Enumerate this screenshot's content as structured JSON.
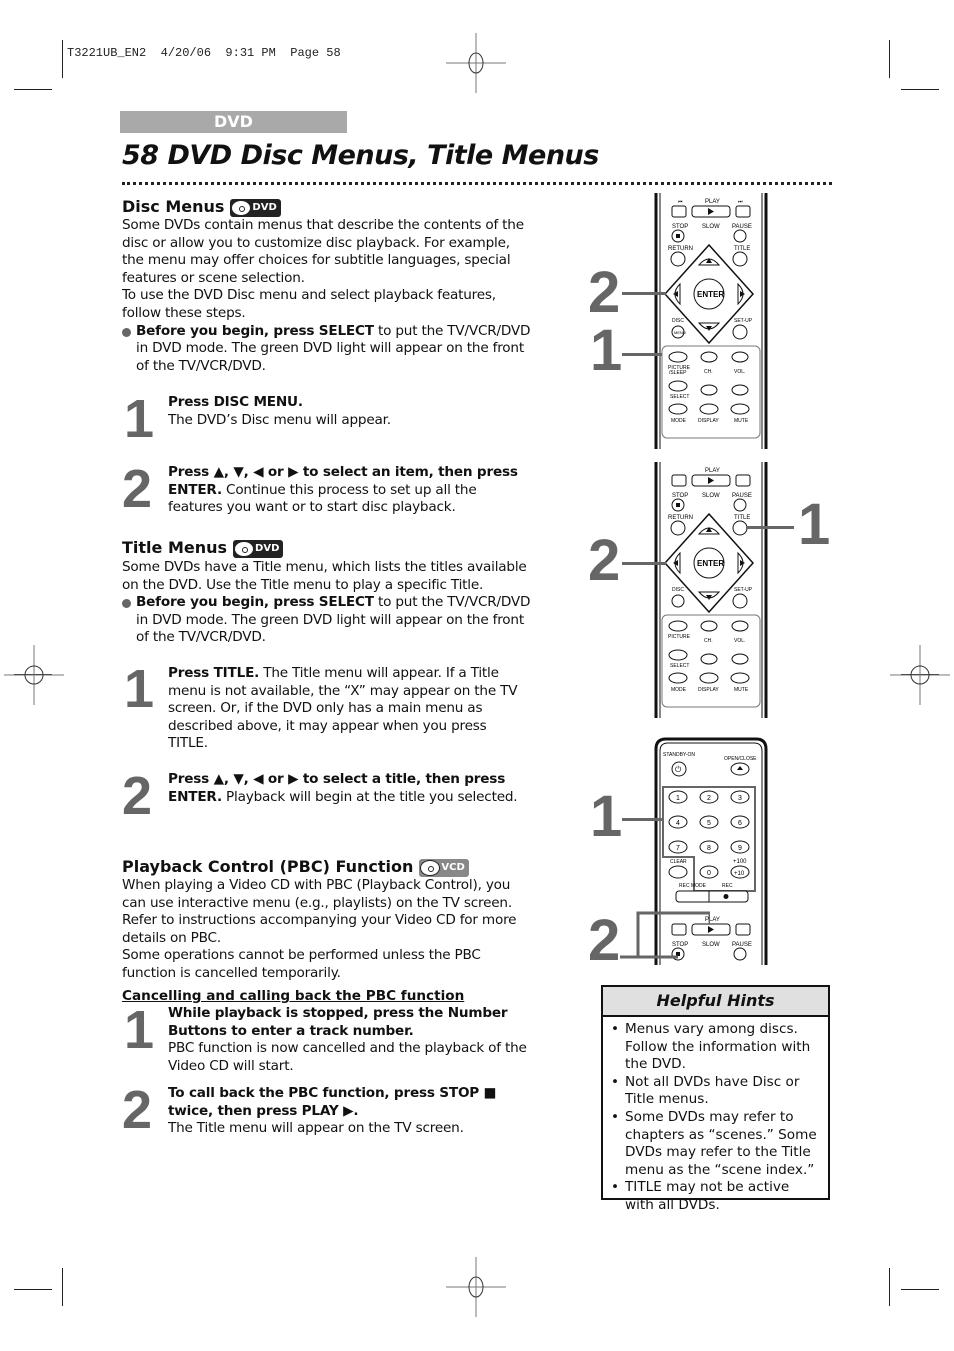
{
  "slug": "T3221UB_EN2  4/20/06  9:31 PM  Page 58",
  "section_tab": "DVD",
  "page_title": "58  DVD Disc Menus, Title Menus",
  "disc_menus": {
    "heading": "Disc Menus",
    "badge": "DVD",
    "intro": "Some DVDs contain menus that describe the contents of the disc or allow you to customize disc playback.  For example, the menu may offer choices for subtitle languages, special features or scene selection.",
    "intro2": "To use the DVD Disc menu and select playback features, follow these steps.",
    "before_bold": "Before you begin, press SELECT",
    "before_rest": " to put the TV/VCR/DVD in DVD mode.  The green DVD light will appear on the front of the TV/VCR/DVD.",
    "steps": [
      {
        "num": "1",
        "bold": "Press DISC MENU.",
        "text": "The DVD’s Disc menu will appear."
      },
      {
        "num": "2",
        "bold": "Press ▲, ▼, ◀ or ▶  to select an item, then press ENTER.",
        "text": "  Continue this process to set up all the features you want or to start disc playback."
      }
    ]
  },
  "title_menus": {
    "heading": "Title Menus",
    "badge": "DVD",
    "intro": "Some DVDs have a Title menu, which lists the titles available on the DVD.  Use the Title menu to play a specific Title.",
    "before_bold": "Before you begin, press SELECT",
    "before_rest": " to put the TV/VCR/DVD in DVD mode.  The green DVD light will appear on the front of the TV/VCR/DVD.",
    "steps": [
      {
        "num": "1",
        "bold": "Press TITLE.",
        "text": " The Title menu will appear. If a Title menu is not available, the “X” may appear on the TV screen. Or, if the DVD only has a main menu as described above, it may appear when you press TITLE."
      },
      {
        "num": "2",
        "bold": "Press ▲, ▼, ◀ or ▶  to select a title, then press ENTER.",
        "text": "  Playback will begin at the title you selected."
      }
    ]
  },
  "pbc": {
    "heading": "Playback Control (PBC) Function",
    "badge": "VCD",
    "intro": "When playing a Video CD with PBC (Playback Control), you can use interactive menu (e.g., playlists) on the TV screen. Refer to instructions accompanying your Video CD for more details on PBC.",
    "intro2": "Some operations cannot be performed unless the PBC function is cancelled temporarily.",
    "subheading": "Cancelling and calling back the PBC function",
    "steps": [
      {
        "num": "1",
        "bold": "While playback is stopped, press the Number Buttons to enter a track number.",
        "text": "PBC function is now cancelled and the playback of the Video CD will start."
      },
      {
        "num": "2",
        "bold": "To call back the PBC function, press STOP ■ twice, then press PLAY ▶.",
        "text": "The Title menu will appear on the TV screen."
      }
    ]
  },
  "helpful_hints": {
    "title": "Helpful Hints",
    "items": [
      "Menus vary among discs. Follow the information with the DVD.",
      "Not all DVDs have Disc or Title menus.",
      "Some DVDs may refer to chapters as “scenes.” Some DVDs may refer to the Title menu as the “scene index.”",
      "TITLE may not be active with all DVDs."
    ]
  },
  "remote_labels": {
    "play": "PLAY",
    "stop": "STOP",
    "slow": "SLOW",
    "pause": "PAUSE",
    "return": "RETURN",
    "title": "TITLE",
    "enter": "ENTER",
    "disc": "DISC",
    "menu": "MENU",
    "setup": "SET-UP",
    "picture": "PICTURE",
    "sleep": "/SLEEP",
    "ch": "CH.",
    "vol": "VOL.",
    "select": "SELECT",
    "mode": "MODE",
    "display": "DISPLAY",
    "mute": "MUTE",
    "standby": "STANDBY-ON",
    "open_close": "OPEN/CLOSE",
    "clear": "CLEAR",
    "plus100": "+100",
    "plus10": "+10",
    "rec_mode": "REC MODE",
    "rec": "REC",
    "digits": [
      "1",
      "2",
      "3",
      "4",
      "5",
      "6",
      "7",
      "8",
      "9",
      "0"
    ]
  },
  "callouts": {
    "remote1": [
      "2",
      "1"
    ],
    "remote2": [
      "1",
      "2"
    ],
    "remote3": [
      "1",
      "2"
    ]
  }
}
